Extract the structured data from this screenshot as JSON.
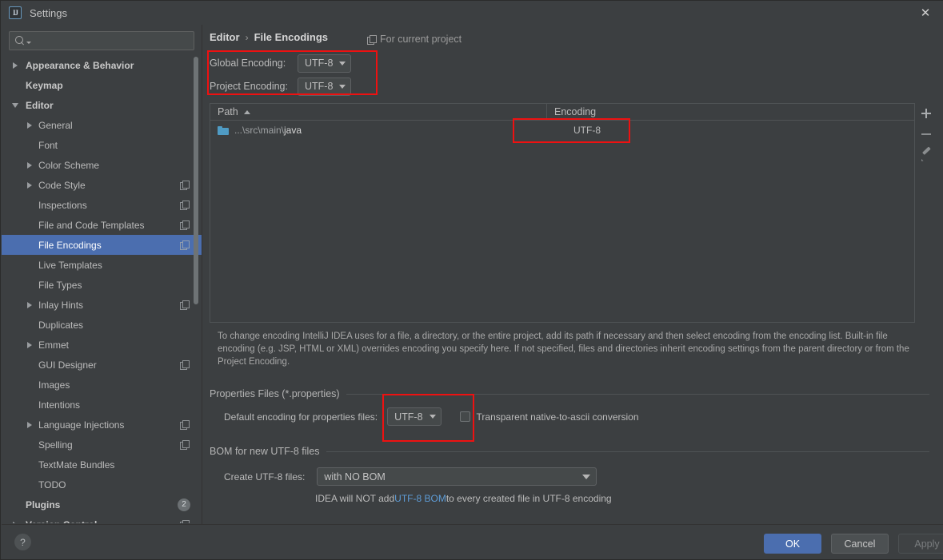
{
  "window": {
    "title": "Settings",
    "app_icon": "IJ",
    "close_icon": "✕"
  },
  "sidebar": {
    "search": {
      "value": "",
      "placeholder": ""
    },
    "items": [
      {
        "label": "Appearance & Behavior",
        "level": 0,
        "arrow": "right",
        "badge": null,
        "selected": false
      },
      {
        "label": "Keymap",
        "level": 0,
        "arrow": "none",
        "badge": null,
        "selected": false
      },
      {
        "label": "Editor",
        "level": 0,
        "arrow": "down",
        "badge": null,
        "selected": false
      },
      {
        "label": "General",
        "level": 1,
        "arrow": "right",
        "badge": null,
        "selected": false
      },
      {
        "label": "Font",
        "level": 1,
        "arrow": "none",
        "badge": null,
        "selected": false
      },
      {
        "label": "Color Scheme",
        "level": 1,
        "arrow": "right",
        "badge": null,
        "selected": false
      },
      {
        "label": "Code Style",
        "level": 1,
        "arrow": "right",
        "badge": "copy",
        "selected": false
      },
      {
        "label": "Inspections",
        "level": 1,
        "arrow": "none",
        "badge": "copy",
        "selected": false
      },
      {
        "label": "File and Code Templates",
        "level": 1,
        "arrow": "none",
        "badge": "copy",
        "selected": false
      },
      {
        "label": "File Encodings",
        "level": 1,
        "arrow": "none",
        "badge": "copy",
        "selected": true
      },
      {
        "label": "Live Templates",
        "level": 1,
        "arrow": "none",
        "badge": null,
        "selected": false
      },
      {
        "label": "File Types",
        "level": 1,
        "arrow": "none",
        "badge": null,
        "selected": false
      },
      {
        "label": "Inlay Hints",
        "level": 1,
        "arrow": "right",
        "badge": "copy",
        "selected": false
      },
      {
        "label": "Duplicates",
        "level": 1,
        "arrow": "none",
        "badge": null,
        "selected": false
      },
      {
        "label": "Emmet",
        "level": 1,
        "arrow": "right",
        "badge": null,
        "selected": false
      },
      {
        "label": "GUI Designer",
        "level": 1,
        "arrow": "none",
        "badge": "copy",
        "selected": false
      },
      {
        "label": "Images",
        "level": 1,
        "arrow": "none",
        "badge": null,
        "selected": false
      },
      {
        "label": "Intentions",
        "level": 1,
        "arrow": "none",
        "badge": null,
        "selected": false
      },
      {
        "label": "Language Injections",
        "level": 1,
        "arrow": "right",
        "badge": "copy",
        "selected": false
      },
      {
        "label": "Spelling",
        "level": 1,
        "arrow": "none",
        "badge": "copy",
        "selected": false
      },
      {
        "label": "TextMate Bundles",
        "level": 1,
        "arrow": "none",
        "badge": null,
        "selected": false
      },
      {
        "label": "TODO",
        "level": 1,
        "arrow": "none",
        "badge": null,
        "selected": false
      },
      {
        "label": "Plugins",
        "level": 0,
        "arrow": "none",
        "badge": "2",
        "selected": false
      },
      {
        "label": "Version Control",
        "level": 0,
        "arrow": "right",
        "badge": "copy",
        "selected": false
      }
    ]
  },
  "content": {
    "breadcrumb": {
      "parent": "Editor",
      "separator": "›",
      "current": "File Encodings"
    },
    "for_current_project": "For current project",
    "global_encoding": {
      "label": "Global Encoding:",
      "value": "UTF-8"
    },
    "project_encoding": {
      "label": "Project Encoding:",
      "value": "UTF-8"
    },
    "table": {
      "columns": [
        "Path",
        "Encoding"
      ],
      "sort_column": "Path",
      "sort_direction": "asc",
      "rows": [
        {
          "path_prefix": "...\\src\\main\\",
          "path_name": "java",
          "encoding": "UTF-8"
        }
      ],
      "tools": [
        "add",
        "remove",
        "edit"
      ]
    },
    "description": "To change encoding IntelliJ IDEA uses for a file, a directory, or the entire project, add its path if necessary and then select encoding from the encoding list. Built-in file encoding (e.g. JSP, HTML or XML) overrides encoding you specify here. If not specified, files and directories inherit encoding settings from the parent directory or from the Project Encoding.",
    "properties_group": {
      "title": "Properties Files (*.properties)",
      "default_encoding_label": "Default encoding for properties files:",
      "default_encoding_value": "UTF-8",
      "transparent_label": "Transparent native-to-ascii conversion",
      "transparent_checked": false
    },
    "bom_group": {
      "title": "BOM for new UTF-8 files",
      "create_label": "Create UTF-8 files:",
      "create_value": "with NO BOM",
      "hint_before": "IDEA will NOT add ",
      "hint_link": "UTF-8 BOM",
      "hint_after": " to every created file in UTF-8 encoding"
    }
  },
  "footer": {
    "help_label": "?",
    "ok_label": "OK",
    "cancel_label": "Cancel",
    "apply_label": "Apply"
  },
  "colors": {
    "accent_blue": "#4b6eaf",
    "annotation_red": "#ee1111",
    "link_blue": "#5e9cd6",
    "background": "#3c3f41",
    "folder_blue": "#4f9bc4"
  }
}
